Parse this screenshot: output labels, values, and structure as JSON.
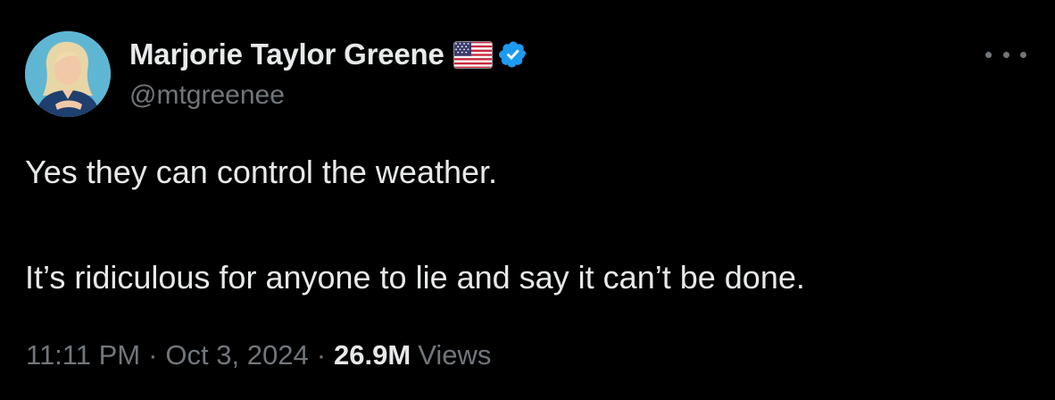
{
  "tweet": {
    "author": {
      "display_name": "Marjorie Taylor Greene",
      "handle": "@mtgreenee",
      "flag_icon": "us-flag-icon",
      "verified_icon": "verified-badge-icon",
      "verified_color": "#1d9bf0"
    },
    "text": [
      "Yes they can control the weather.",
      "It’s ridiculous for anyone to lie and say it can’t be done."
    ],
    "meta": {
      "time": "11:11 PM",
      "separator": "·",
      "date": "Oct 3, 2024",
      "views_count": "26.9M",
      "views_label": "Views"
    },
    "more_icon": "more-options-icon"
  }
}
